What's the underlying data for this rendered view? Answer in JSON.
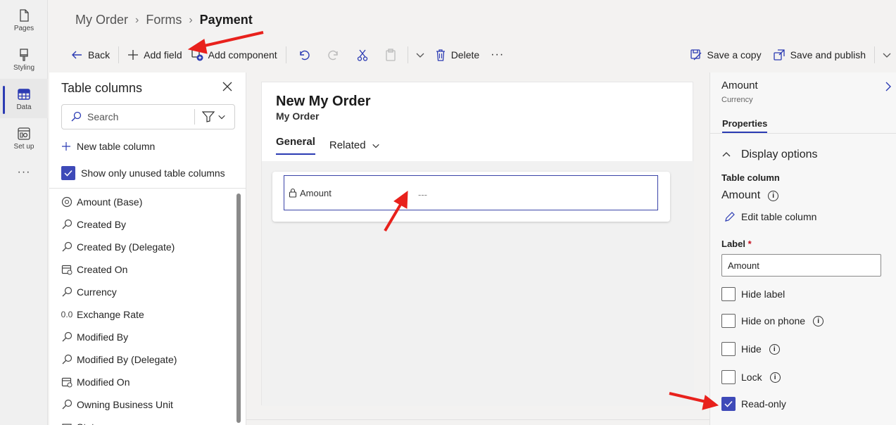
{
  "rail": {
    "items": [
      {
        "label": "Pages",
        "icon": "page-icon"
      },
      {
        "label": "Styling",
        "icon": "paintbrush-icon"
      },
      {
        "label": "Data",
        "icon": "table-icon"
      },
      {
        "label": "Set up",
        "icon": "settings-app-icon"
      }
    ],
    "more": "···"
  },
  "breadcrumb": {
    "items": [
      "My Order",
      "Forms"
    ],
    "current": "Payment"
  },
  "toolbar": {
    "back": "Back",
    "add_field": "Add field",
    "add_component": "Add component",
    "delete": "Delete",
    "more": "···",
    "save_copy": "Save a copy",
    "save_publish": "Save and publish"
  },
  "left_panel": {
    "title": "Table columns",
    "search_placeholder": "Search",
    "new_column": "New table column",
    "show_unused": "Show only unused table columns",
    "show_unused_checked": true,
    "columns": [
      {
        "label": "Amount (Base)",
        "icon": "currency-icon"
      },
      {
        "label": "Created By",
        "icon": "lookup-icon"
      },
      {
        "label": "Created By (Delegate)",
        "icon": "lookup-icon"
      },
      {
        "label": "Created On",
        "icon": "calendar-icon"
      },
      {
        "label": "Currency",
        "icon": "lookup-icon"
      },
      {
        "label": "Exchange Rate",
        "icon": "decimal-icon",
        "glyph": "0.0"
      },
      {
        "label": "Modified By",
        "icon": "lookup-icon"
      },
      {
        "label": "Modified By (Delegate)",
        "icon": "lookup-icon"
      },
      {
        "label": "Modified On",
        "icon": "calendar-icon"
      },
      {
        "label": "Owning Business Unit",
        "icon": "lookup-icon"
      },
      {
        "label": "Status",
        "icon": "option-icon"
      }
    ]
  },
  "form": {
    "title": "New My Order",
    "subtitle": "My Order",
    "tabs": {
      "general": "General",
      "related": "Related"
    },
    "field": {
      "label": "Amount",
      "value": "---"
    }
  },
  "right_panel": {
    "title": "Amount",
    "subtitle": "Currency",
    "tab": "Properties",
    "section": "Display options",
    "table_column_heading": "Table column",
    "table_column_value": "Amount",
    "edit_table_column": "Edit table column",
    "label_heading": "Label",
    "label_required": "*",
    "label_value": "Amount",
    "options": [
      {
        "label": "Hide label",
        "checked": false,
        "info": false
      },
      {
        "label": "Hide on phone",
        "checked": false,
        "info": true
      },
      {
        "label": "Hide",
        "checked": false,
        "info": true
      },
      {
        "label": "Lock",
        "checked": false,
        "info": true
      },
      {
        "label": "Read-only",
        "checked": true,
        "info": false
      }
    ]
  },
  "colors": {
    "accent": "#3e4ab8",
    "annotation": "#e8211c"
  }
}
